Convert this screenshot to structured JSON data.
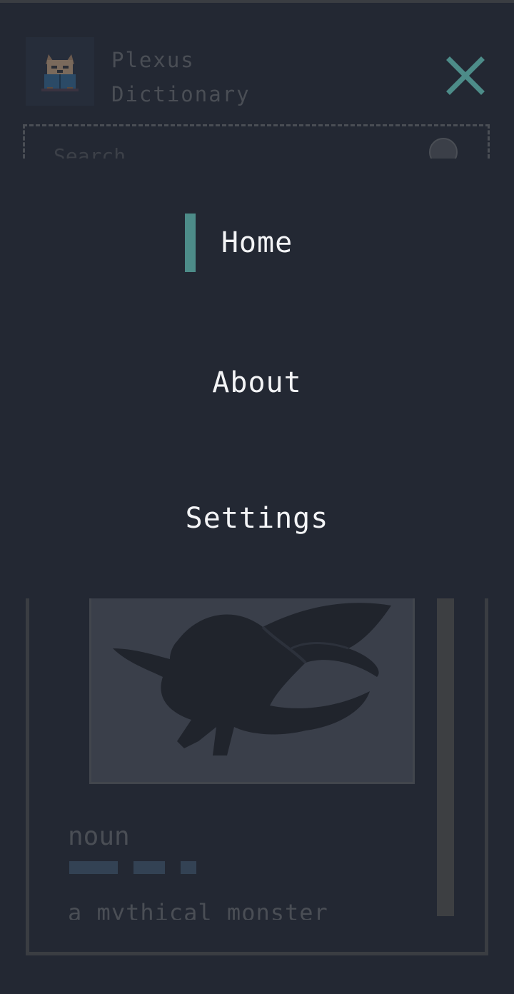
{
  "header": {
    "title": "Plexus Dictionary",
    "logo_icon": "fox-reading-book-icon",
    "close_icon": "close-icon"
  },
  "search": {
    "placeholder": "Search"
  },
  "menu": {
    "items": [
      {
        "label": "Home",
        "active": true
      },
      {
        "label": "About",
        "active": false
      },
      {
        "label": "Settings",
        "active": false
      }
    ]
  },
  "entry": {
    "image_icon": "dragon-illustration",
    "part_of_speech": "noun",
    "definition": "a mythical monster"
  },
  "colors": {
    "background": "#232833",
    "accent": "#4d8c89",
    "menu_text": "#f3f4f6",
    "dim_text": "#4a4e55"
  }
}
